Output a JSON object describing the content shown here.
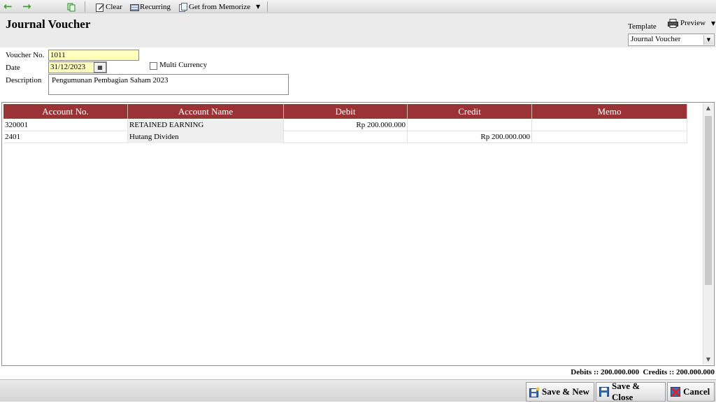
{
  "toolbar": {
    "back_icon": "back-arrow-icon",
    "forward_icon": "forward-arrow-icon",
    "copy_icon": "copy-icon",
    "clear_label": "Clear",
    "recurring_label": "Recurring",
    "memorize_label": "Get from Memorize"
  },
  "header": {
    "title": "Journal Voucher",
    "template_label": "Template",
    "preview_label": "Preview",
    "template_value": "Journal Voucher"
  },
  "form": {
    "voucher_label": "Voucher No.",
    "voucher_value": "1011",
    "date_label": "Date",
    "date_value": "31/12/2023",
    "multi_currency_label": "Multi Currency",
    "multi_currency_checked": false,
    "description_label": "Description",
    "description_value": "Pengumunan Pembagian Saham 2023"
  },
  "grid": {
    "columns": [
      "Account No.",
      "Account Name",
      "Debit",
      "Credit",
      "Memo"
    ],
    "rows": [
      {
        "account_no": "320001",
        "account_name": "RETAINED EARNING",
        "debit": "Rp 200.000.000",
        "credit": "",
        "memo": ""
      },
      {
        "account_no": "2401",
        "account_name": "Hutang Dividen",
        "debit": "",
        "credit": "Rp 200.000.000",
        "memo": ""
      }
    ]
  },
  "totals": {
    "text": "Debits :: 200.000.000  Credits :: 200.000.000"
  },
  "footer": {
    "save_new_label": "Save & New",
    "save_close_label": "Save & Close",
    "cancel_label": "Cancel"
  },
  "colors": {
    "grid_header": "#9b3336",
    "required_field": "#ffffc0",
    "toolbar_arrow": "#3aa52b"
  }
}
